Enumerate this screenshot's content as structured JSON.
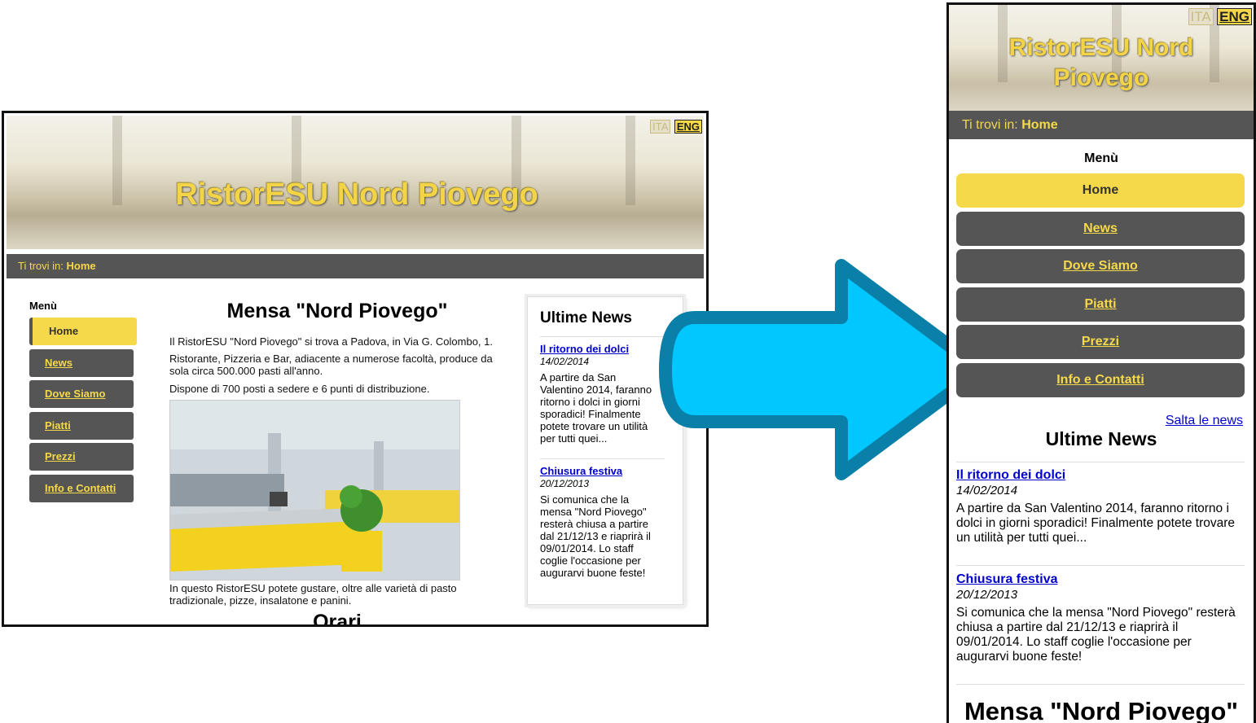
{
  "desktop": {
    "lang": {
      "ita": "ITA",
      "eng": "ENG"
    },
    "site_title": "RistorESU Nord Piovego",
    "breadcrumb": {
      "prefix": "Ti trovi in:",
      "current": "Home"
    },
    "menu_label": "Menù",
    "menu": [
      "Home",
      "News",
      "Dove Siamo",
      "Piatti",
      "Prezzi",
      "Info e Contatti"
    ],
    "main": {
      "title": "Mensa \"Nord Piovego\"",
      "p1": "Il RistorESU \"Nord Piovego\" si trova a Padova, in Via G. Colombo, 1.",
      "p2": "Ristorante, Pizzeria e Bar, adiacente a numerose facoltà, produce da sola circa 500.000 pasti all'anno.",
      "p3": "Dispone di 700 posti a sedere e 6 punti di distribuzione.",
      "caption": "In questo RistorESU potete gustare, oltre alle varietà di pasto tradizionale, pizze, insalatone e panini.",
      "orari": "Orari"
    },
    "news": {
      "title": "Ultime News",
      "items": [
        {
          "title": "Il ritorno dei dolci",
          "date": "14/02/2014",
          "text": "A partire da San Valentino 2014, faranno ritorno i dolci in giorni sporadici! Finalmente potete trovare un utilità per tutti quei..."
        },
        {
          "title": "Chiusura festiva",
          "date": "20/12/2013",
          "text": "Si comunica che la mensa \"Nord Piovego\" resterà chiusa a partire dal 21/12/13 e riaprirà il 09/01/2014. Lo staff coglie l'occasione per augurarvi buone feste!"
        }
      ]
    }
  },
  "mobile": {
    "lang": {
      "ita": "ITA",
      "eng": "ENG"
    },
    "site_title_line1": "RistorESU Nord",
    "site_title_line2": "Piovego",
    "breadcrumb": {
      "prefix": "Ti trovi in:",
      "current": "Home"
    },
    "menu_label": "Menù",
    "menu": [
      "Home",
      "News",
      "Dove Siamo",
      "Piatti",
      "Prezzi",
      "Info e Contatti"
    ],
    "skip_news": "Salta le news",
    "news": {
      "title": "Ultime News",
      "items": [
        {
          "title": "Il ritorno dei dolci",
          "date": "14/02/2014",
          "text": "A partire da San Valentino 2014, faranno ritorno i dolci in giorni sporadici! Finalmente potete trovare un utilità per tutti quei..."
        },
        {
          "title": "Chiusura festiva",
          "date": "20/12/2013",
          "text": "Si comunica che la mensa \"Nord Piovego\" resterà chiusa a partire dal 21/12/13 e riaprirà il 09/01/2014. Lo staff coglie l'occasione per augurarvi buone feste!"
        }
      ]
    },
    "main_title": "Mensa \"Nord Piovego\""
  },
  "colors": {
    "accent": "#f5d94a",
    "dark": "#555555",
    "arrow": "#00c8ff",
    "arrow_border": "#0a7fa8",
    "link": "#0000cc"
  }
}
